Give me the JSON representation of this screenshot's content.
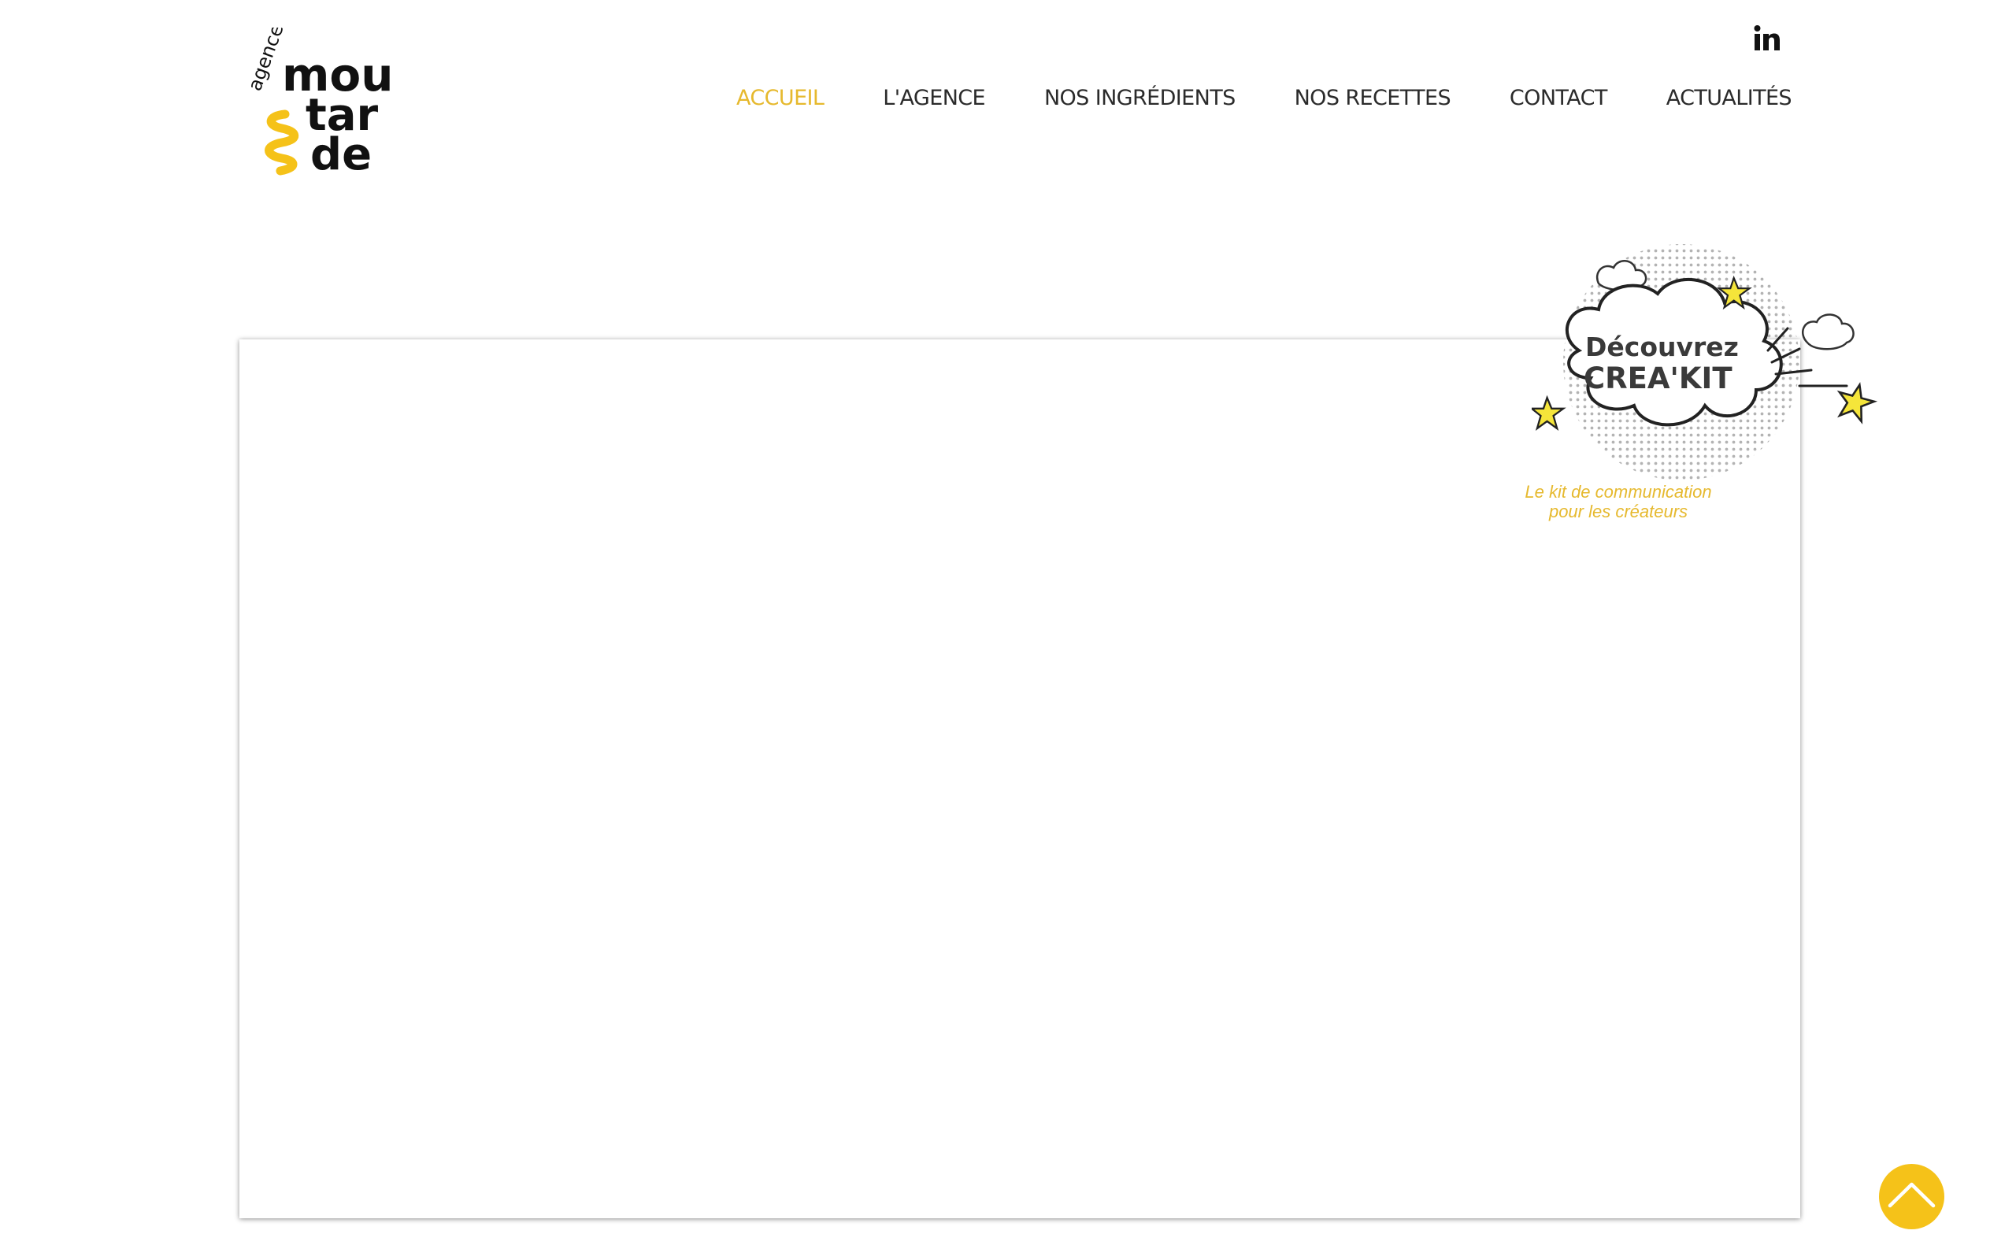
{
  "brand": {
    "logo_small": "agence",
    "logo_line1": "mou",
    "logo_line2": "tar",
    "logo_line3": "de",
    "accent_color": "#e6b92e",
    "text_color": "#2b2b2b"
  },
  "social": {
    "linkedin_label": "in"
  },
  "nav": {
    "items": [
      {
        "label": "ACCUEIL",
        "active": true
      },
      {
        "label": "L'AGENCE"
      },
      {
        "label": "NOS INGRÉDIENTS"
      },
      {
        "label": "NOS RECETTES"
      },
      {
        "label": "CONTACT"
      },
      {
        "label": "ACTUALITÉS"
      }
    ]
  },
  "promo": {
    "title_line1": "Découvrez",
    "title_line2": "CREA'KIT",
    "caption_line1": "Le kit de communication",
    "caption_line2": "pour les créateurs"
  },
  "icons": {
    "scroll_top": "chevron-up-icon",
    "linkedin": "linkedin-icon"
  }
}
